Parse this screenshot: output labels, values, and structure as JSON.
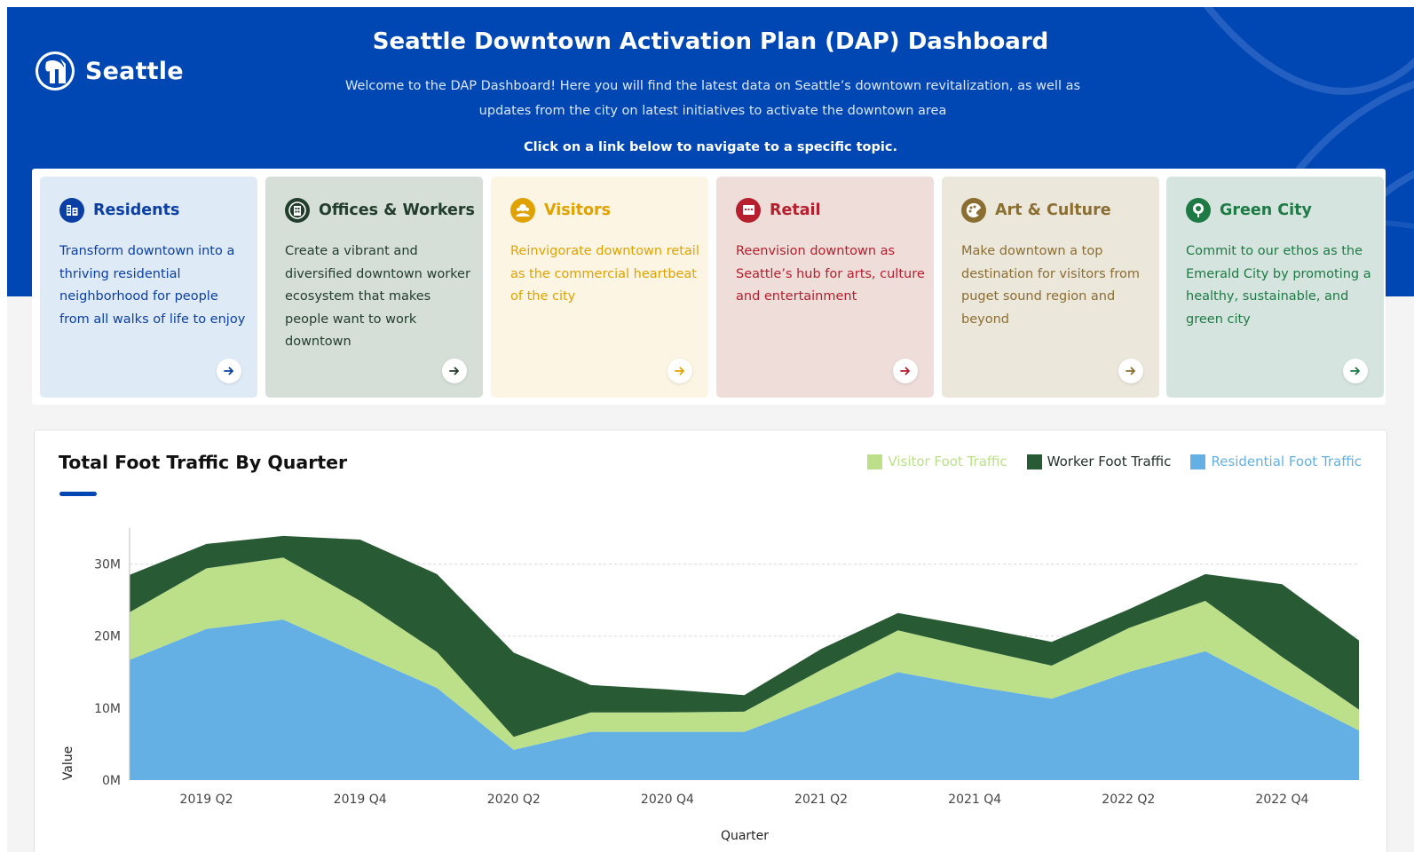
{
  "brand": {
    "name": "Seattle"
  },
  "header": {
    "title": "Seattle Downtown Activation Plan (DAP) Dashboard",
    "intro": "Welcome to the DAP Dashboard! Here you will find the latest data on Seattle’s downtown revitalization, as well as updates from the city on latest initiatives to activate the downtown area",
    "cta": "Click on a link below to navigate to a specific topic."
  },
  "cards": [
    {
      "title": "Residents",
      "desc": "Transform downtown into a thriving residential neighborhood for people from all walks of life to enjoy",
      "icon": "residents-icon",
      "bg": "#deebf7",
      "color": "#0b3fa3"
    },
    {
      "title": "Offices & Workers",
      "desc": "Create a vibrant and diversified downtown worker ecosystem that makes people want to work downtown",
      "icon": "offices-icon",
      "bg": "#d5dfd8",
      "color": "#233d2c"
    },
    {
      "title": "Visitors",
      "desc": "Reinvigorate downtown retail as the commercial heartbeat of the city",
      "icon": "visitors-icon",
      "bg": "#fdf5e3",
      "color": "#e0a200"
    },
    {
      "title": "Retail",
      "desc": "Reenvision downtown as Seattle’s hub for arts, culture and entertainment",
      "icon": "retail-icon",
      "bg": "#eeddd9",
      "color": "#b51f2e"
    },
    {
      "title": "Art & Culture",
      "desc": "Make downtown a top destination for visitors from puget sound region and beyond",
      "icon": "art-culture-icon",
      "bg": "#ece7db",
      "color": "#8a6e32"
    },
    {
      "title": "Green City",
      "desc": "Commit to our ethos as the Emerald City by promoting a healthy, sustainable, and green city",
      "icon": "green-city-icon",
      "bg": "#d5e4de",
      "color": "#1e7a45"
    }
  ],
  "chart_data": {
    "type": "area",
    "stacked": true,
    "title": "Total Foot Traffic By Quarter",
    "xlabel": "Quarter",
    "ylabel": "Value",
    "ylim": [
      0,
      35000000
    ],
    "y_ticks": [
      {
        "label": "0M",
        "value": 0
      },
      {
        "label": "10M",
        "value": 10000000
      },
      {
        "label": "20M",
        "value": 20000000
      },
      {
        "label": "30M",
        "value": 30000000
      }
    ],
    "x": [
      "2019 Q1",
      "2019 Q2",
      "2019 Q3",
      "2019 Q4",
      "2020 Q1",
      "2020 Q2",
      "2020 Q3",
      "2020 Q4",
      "2021 Q1",
      "2021 Q2",
      "2021 Q3",
      "2021 Q4",
      "2022 Q1",
      "2022 Q2",
      "2022 Q3",
      "2022 Q4",
      "2023 Q1"
    ],
    "x_tick_labels": [
      "2019 Q2",
      "2019 Q4",
      "2020 Q2",
      "2020 Q4",
      "2021 Q2",
      "2021 Q4",
      "2022 Q2",
      "2022 Q4"
    ],
    "grid": "horizontal dashed",
    "legend_position": "top-right",
    "series": [
      {
        "name": "Residential Foot Traffic",
        "color": "#64b0e4",
        "values": [
          16.7,
          21.0,
          22.3,
          17.5,
          12.8,
          4.2,
          6.7,
          6.7,
          6.7,
          10.8,
          15.0,
          13.0,
          11.3,
          15.0,
          17.9,
          12.3,
          6.9
        ]
      },
      {
        "name": "Visitor Foot Traffic",
        "color": "#bce08a",
        "values": [
          6.6,
          8.4,
          8.6,
          7.4,
          5.0,
          1.8,
          2.7,
          2.7,
          2.8,
          4.5,
          5.8,
          5.3,
          4.6,
          6.1,
          7.0,
          4.8,
          2.9
        ]
      },
      {
        "name": "Worker Foot Traffic",
        "color": "#285a34",
        "values": [
          5.2,
          3.4,
          3.0,
          8.5,
          10.8,
          11.7,
          3.8,
          3.2,
          2.3,
          2.9,
          2.4,
          3.0,
          3.3,
          2.6,
          3.7,
          10.1,
          9.6
        ]
      }
    ],
    "value_unit": "millions"
  }
}
